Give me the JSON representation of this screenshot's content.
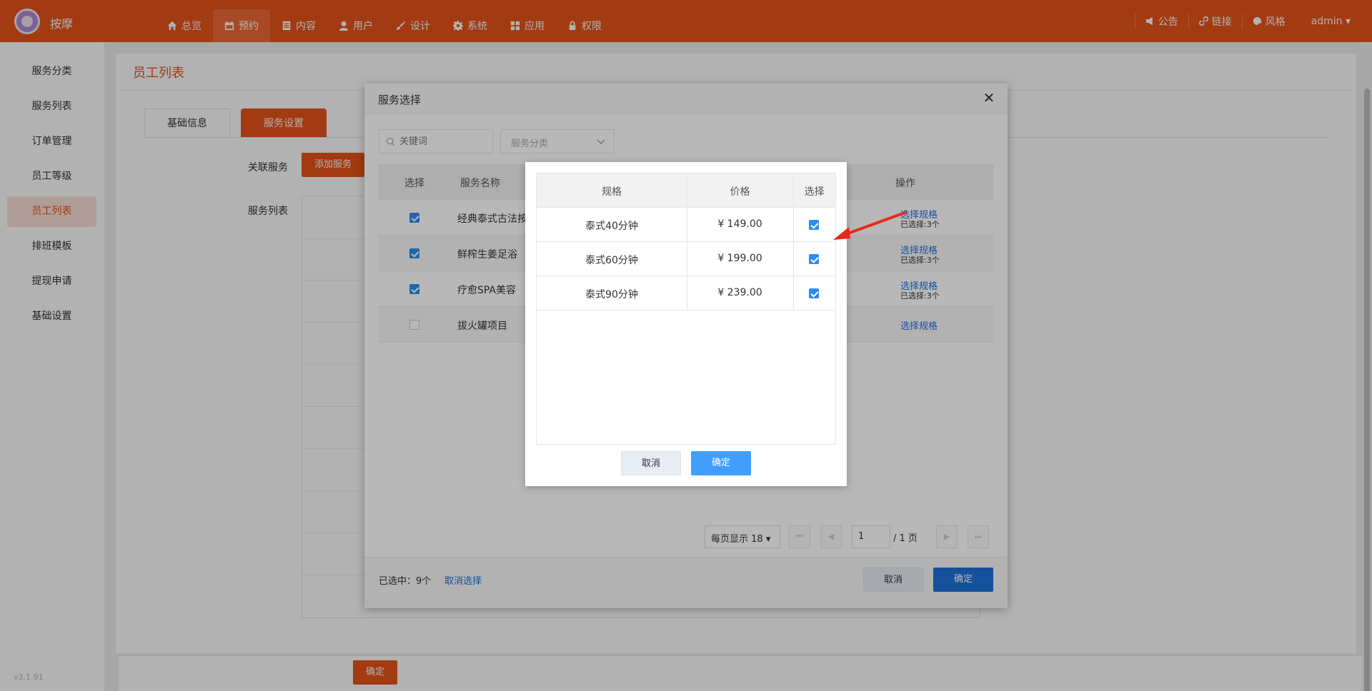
{
  "app": {
    "name": "按摩",
    "version": "v3.1.91"
  },
  "nav": [
    {
      "label": "总览",
      "icon": "home-icon"
    },
    {
      "label": "预约",
      "icon": "calendar-icon"
    },
    {
      "label": "内容",
      "icon": "document-icon"
    },
    {
      "label": "用户",
      "icon": "user-icon"
    },
    {
      "label": "设计",
      "icon": "paint-brush-icon"
    },
    {
      "label": "系统",
      "icon": "gear-icon"
    },
    {
      "label": "应用",
      "icon": "grid-icon"
    },
    {
      "label": "权限",
      "icon": "lock-icon"
    }
  ],
  "nav_active": "预约",
  "topright": {
    "notice": "公告",
    "link": "链接",
    "style": "风格",
    "user": "admin"
  },
  "sidebar": {
    "items": [
      {
        "label": "服务分类"
      },
      {
        "label": "服务列表"
      },
      {
        "label": "订单管理"
      },
      {
        "label": "员工等级"
      },
      {
        "label": "员工列表"
      },
      {
        "label": "排班模板"
      },
      {
        "label": "提现申请"
      },
      {
        "label": "基础设置"
      }
    ],
    "active": "员工列表"
  },
  "page": {
    "title": "员工列表",
    "tabs": [
      {
        "label": "基础信息"
      },
      {
        "label": "服务设置"
      }
    ],
    "active_tab": "服务设置",
    "related_label": "关联服务",
    "add_service": "添加服务",
    "list_label": "服务列表",
    "confirm": "确定"
  },
  "service_modal": {
    "title": "服务选择",
    "search_placeholder": "关键词",
    "category_placeholder": "服务分类",
    "columns": {
      "select": "选择",
      "name": "服务名称",
      "action": "操作"
    },
    "rows": [
      {
        "name": "经典泰式古法按",
        "checked": true,
        "action": "选择规格",
        "sub": "已选择:3个"
      },
      {
        "name": "鲜榨生姜足浴",
        "checked": true,
        "action": "选择规格",
        "sub": "已选择:3个"
      },
      {
        "name": "疗愈SPA美容",
        "checked": true,
        "action": "选择规格",
        "sub": "已选择:3个"
      },
      {
        "name": "拔火罐项目",
        "checked": false,
        "action": "选择规格",
        "sub": ""
      }
    ],
    "pagination": {
      "page_size": "每页显示 18",
      "page": "1",
      "total": "/ 1 页"
    },
    "selected_text": "已选中：9个",
    "cancel_selection": "取消选择",
    "cancel": "取消",
    "confirm": "确定"
  },
  "spec_modal": {
    "columns": {
      "spec": "规格",
      "price": "价格",
      "select": "选择"
    },
    "rows": [
      {
        "spec": "泰式40分钟",
        "price": "¥ 149.00",
        "checked": true
      },
      {
        "spec": "泰式60分钟",
        "price": "¥ 199.00",
        "checked": true
      },
      {
        "spec": "泰式90分钟",
        "price": "¥ 239.00",
        "checked": true
      }
    ],
    "cancel": "取消",
    "confirm": "确定"
  },
  "colors": {
    "brand": "#e8541a",
    "primary_blue": "#1e6fd9",
    "checkbox_blue": "#2d8cf0"
  }
}
